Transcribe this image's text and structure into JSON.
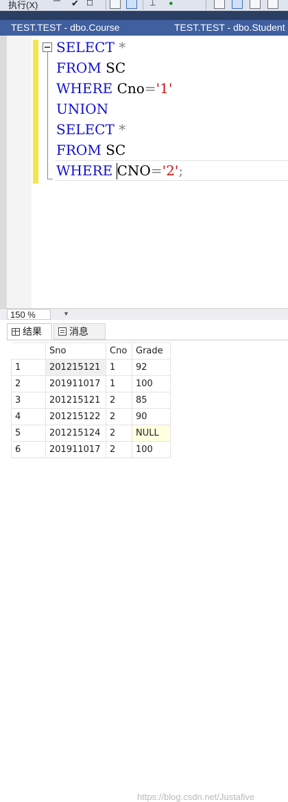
{
  "toolbar": {
    "execute_label": "执行(X)",
    "execute_check": "✔",
    "icons": [
      "execute-icon",
      "stop-icon",
      "check-icon",
      "parse-icon",
      "results-to-text-icon",
      "results-to-grid-icon",
      "plan-icon",
      "include-stats-icon"
    ]
  },
  "tabs": [
    {
      "label": "TEST.TEST - dbo.Course"
    },
    {
      "label": "TEST.TEST - dbo.Student"
    }
  ],
  "editor": {
    "lines": [
      [
        {
          "t": "SELECT",
          "c": "kw"
        },
        {
          "t": " ",
          "c": ""
        },
        {
          "t": "*",
          "c": "op"
        }
      ],
      [
        {
          "t": "FROM",
          "c": "kw"
        },
        {
          "t": " SC",
          "c": ""
        }
      ],
      [
        {
          "t": "WHERE",
          "c": "kw"
        },
        {
          "t": " Cno",
          "c": ""
        },
        {
          "t": "=",
          "c": "op"
        },
        {
          "t": "'1'",
          "c": "str"
        }
      ],
      [
        {
          "t": "UNION",
          "c": "kw"
        }
      ],
      [
        {
          "t": "SELECT",
          "c": "kw"
        },
        {
          "t": " ",
          "c": ""
        },
        {
          "t": "*",
          "c": "op"
        }
      ],
      [
        {
          "t": "FROM",
          "c": "kw"
        },
        {
          "t": " SC",
          "c": ""
        }
      ],
      [
        {
          "t": "WHERE",
          "c": "kw"
        },
        {
          "t": " CNO",
          "c": ""
        },
        {
          "t": "=",
          "c": "op"
        },
        {
          "t": "'2'",
          "c": "str"
        },
        {
          "t": ";",
          "c": "op"
        }
      ]
    ],
    "colors": {
      "keyword": "#1010d0",
      "string": "#d01010",
      "operator": "#808080"
    }
  },
  "zoom": {
    "value": "150 %"
  },
  "results": {
    "tabs": [
      {
        "label": "结果"
      },
      {
        "label": "消息"
      }
    ],
    "columns": [
      "",
      "Sno",
      "Cno",
      "Grade"
    ],
    "rows": [
      [
        "1",
        "201215121",
        "1",
        "92"
      ],
      [
        "2",
        "201911017",
        "1",
        "100"
      ],
      [
        "3",
        "201215121",
        "2",
        "85"
      ],
      [
        "4",
        "201215122",
        "2",
        "90"
      ],
      [
        "5",
        "201215124",
        "2",
        "NULL"
      ],
      [
        "6",
        "201911017",
        "2",
        "100"
      ]
    ]
  },
  "watermark": "https://blog.csdn.net/Justafive"
}
